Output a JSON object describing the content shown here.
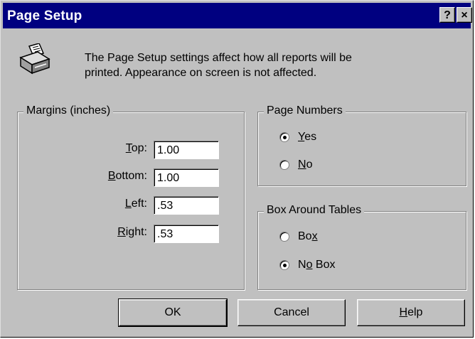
{
  "window": {
    "title": "Page Setup",
    "help_glyph": "?",
    "close_glyph": "×"
  },
  "intro": {
    "icon": "printer-icon",
    "line1": "The Page Setup settings affect how all reports will be",
    "line2": "printed.  Appearance on screen is not affected."
  },
  "margins": {
    "legend": "Margins (inches)",
    "fields": [
      {
        "mnemonic": "T",
        "rest": "op:",
        "value": "1.00"
      },
      {
        "mnemonic": "B",
        "rest": "ottom:",
        "value": "1.00"
      },
      {
        "mnemonic": "L",
        "rest": "eft:",
        "value": ".53"
      },
      {
        "mnemonic": "R",
        "rest": "ight:",
        "value": ".53"
      }
    ]
  },
  "page_numbers": {
    "legend": "Page Numbers",
    "options": [
      {
        "mnemonic": "Y",
        "rest": "es",
        "checked": true
      },
      {
        "mnemonic": "N",
        "rest": "o",
        "checked": false
      }
    ]
  },
  "box_around_tables": {
    "legend": "Box Around Tables",
    "options": [
      {
        "pre": "Bo",
        "mnemonic": "x",
        "rest": "",
        "checked": false
      },
      {
        "pre": "N",
        "mnemonic": "o",
        "rest": " Box",
        "checked": true
      }
    ]
  },
  "buttons": {
    "ok": "OK",
    "cancel": "Cancel",
    "help_mnemonic": "H",
    "help_rest": "elp"
  }
}
